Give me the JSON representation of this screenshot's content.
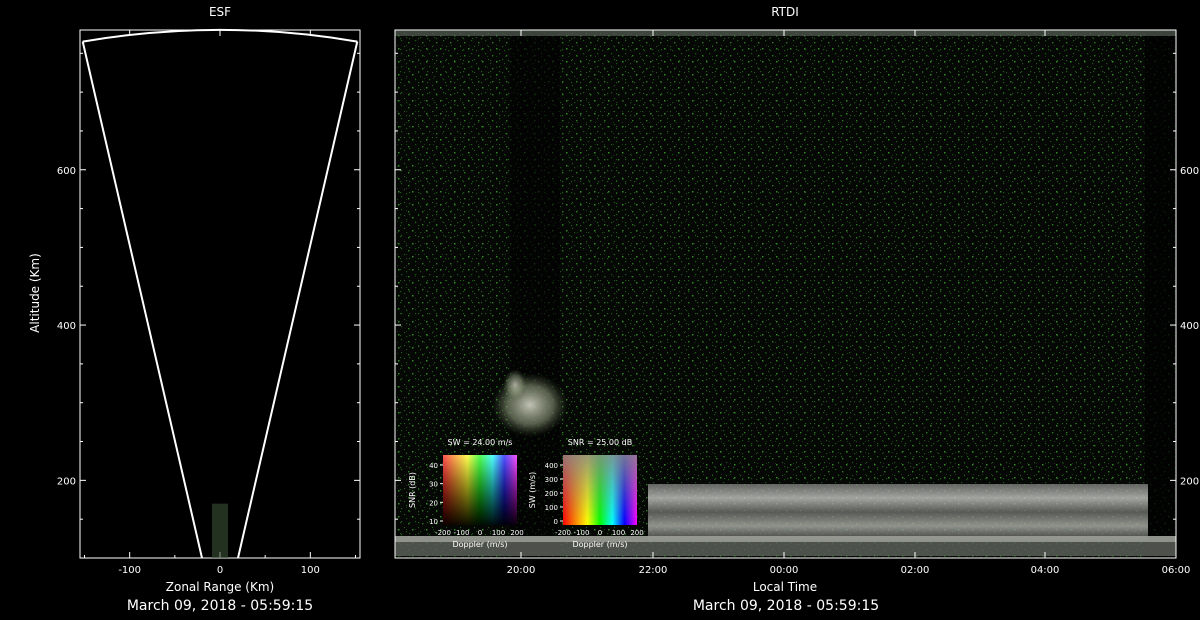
{
  "chart_data": [
    {
      "type": "scatter",
      "panel": "ESF",
      "title": "ESF",
      "xlabel": "Zonal Range (Km)",
      "ylabel": "Altitude (Km)",
      "xlim": [
        -155,
        155
      ],
      "ylim": [
        100,
        780
      ],
      "x_ticks": [
        -100,
        0,
        100
      ],
      "y_ticks": [
        200,
        400,
        600
      ],
      "fan_boundary": {
        "apex": [
          0,
          100
        ],
        "left_edge_top": [
          -152,
          765
        ],
        "right_edge_top": [
          152,
          765
        ],
        "arc_top": 780
      },
      "date_label": "March 09, 2018 - 05:59:15"
    },
    {
      "type": "heatmap",
      "panel": "RTDI",
      "title": "RTDI",
      "xlabel": "Local Time",
      "ylabel": "",
      "x_ticks": [
        "20:00",
        "22:00",
        "00:00",
        "02:00",
        "04:00",
        "06:00"
      ],
      "y_ticks": [
        200,
        400,
        600
      ],
      "ylim": [
        100,
        780
      ],
      "date_label": "March 09, 2018 - 05:59:15",
      "legends": [
        {
          "title": "SW = 24.00 m/s",
          "xlabel": "Doppler (m/s)",
          "ylabel": "SNR (dB)",
          "x_ticks": [
            "-200",
            "-100",
            "0",
            "100",
            "200"
          ],
          "y_ticks": [
            "40",
            "30",
            "20",
            "10"
          ]
        },
        {
          "title": "SNR = 25.00 dB",
          "xlabel": "Doppler (m/s)",
          "ylabel": "SW (m/s)",
          "x_ticks": [
            "-200",
            "-100",
            "0",
            "100",
            "200"
          ],
          "y_ticks": [
            "400",
            "300",
            "200",
            "100",
            "0"
          ]
        }
      ]
    }
  ]
}
